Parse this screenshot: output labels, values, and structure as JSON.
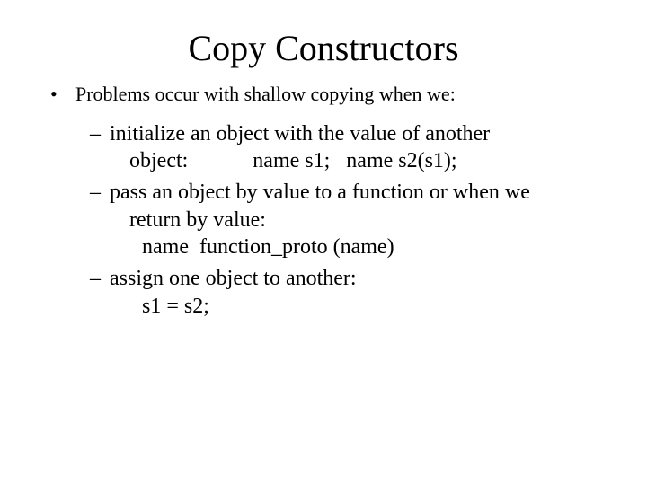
{
  "title": "Copy Constructors",
  "bullets": {
    "l1": {
      "item1": "Problems occur with shallow copying when we:"
    },
    "l2": {
      "item1_line1": "initialize an object with the value of another",
      "item1_line2": "object:            name s1;   name s2(s1);",
      "item2_line1": "pass an object by value to a function or when we",
      "item2_line2": "return by value:",
      "item2_line3": "name  function_proto (name)",
      "item3_line1": "assign one object to another:",
      "item3_line2": "s1 = s2;"
    }
  }
}
